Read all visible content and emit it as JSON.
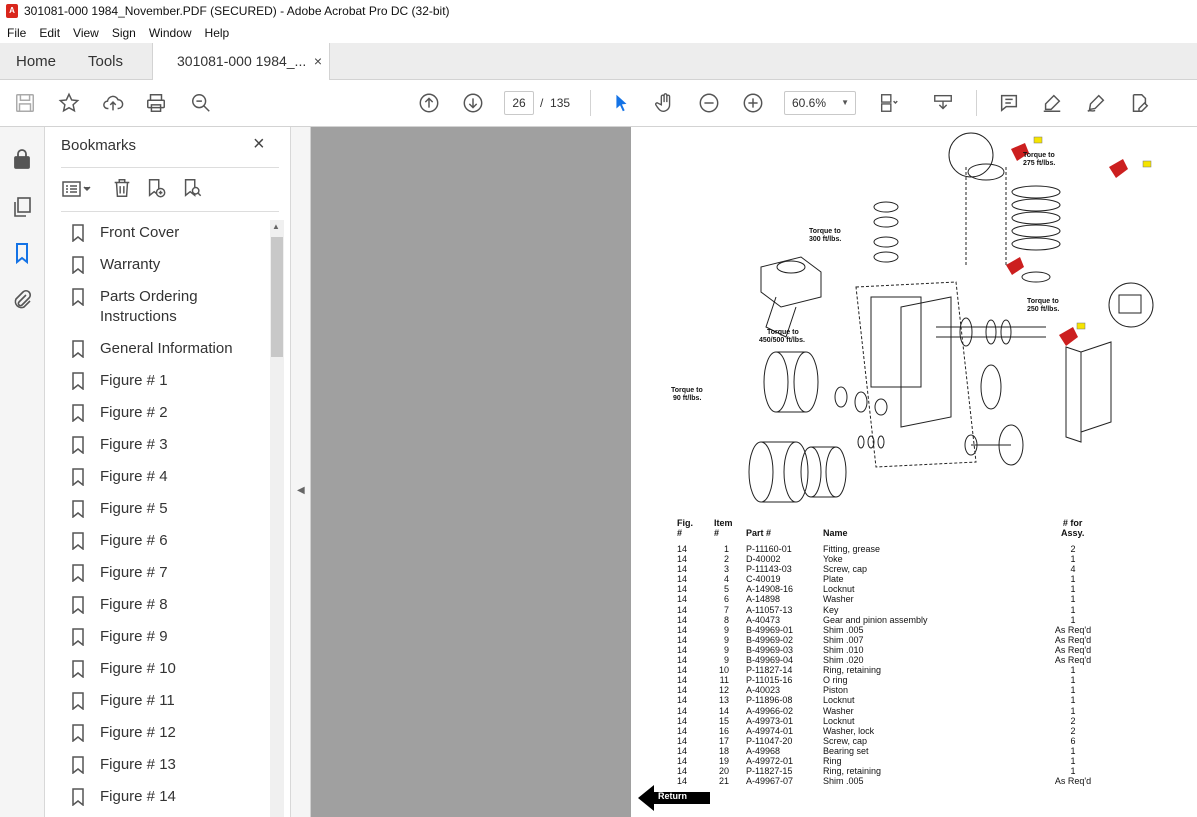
{
  "window": {
    "title": "301081-000 1984_November.PDF (SECURED) - Adobe Acrobat Pro DC (32-bit)"
  },
  "menu": [
    "File",
    "Edit",
    "View",
    "Sign",
    "Window",
    "Help"
  ],
  "tabs": {
    "home": "Home",
    "tools": "Tools",
    "document": "301081-000 1984_...",
    "close": "×"
  },
  "toolbar": {
    "page_current": "26",
    "page_separator": "/",
    "page_total": "135",
    "zoom": "60.6%"
  },
  "bookmarks_panel": {
    "title": "Bookmarks",
    "close": "×",
    "items": [
      "Front Cover",
      "Warranty",
      "Parts Ordering Instructions",
      "General Information",
      "Figure # 1",
      "Figure # 2",
      "Figure # 3",
      "Figure # 4",
      "Figure # 5",
      "Figure # 6",
      "Figure # 7",
      "Figure # 8",
      "Figure # 9",
      "Figure # 10",
      "Figure # 11",
      "Figure # 12",
      "Figure # 13",
      "Figure # 14"
    ]
  },
  "document": {
    "diagram_labels": {
      "torque_275": "Torque to\n275 ft/lbs.",
      "torque_300": "Torque to\n300 ft/lbs.",
      "torque_450": "Torque to\n450/500 ft/lbs.",
      "torque_90": "Torque to\n90 ft/lbs.",
      "torque_250": "Torque to\n250 ft/lbs."
    },
    "table_headers": {
      "fig": "Fig.\n#",
      "item": "Item\n#",
      "part": "Part #",
      "name": "Name",
      "qty": "# for\nAssy."
    },
    "rows": [
      [
        "14",
        "1",
        "P-11160-01",
        "Fitting, grease",
        "2"
      ],
      [
        "14",
        "2",
        "D-40002",
        "Yoke",
        "1"
      ],
      [
        "14",
        "3",
        "P-11143-03",
        "Screw, cap",
        "4"
      ],
      [
        "14",
        "4",
        "C-40019",
        "Plate",
        "1"
      ],
      [
        "14",
        "5",
        "A-14908-16",
        "Locknut",
        "1"
      ],
      [
        "14",
        "6",
        "A-14898",
        "Washer",
        "1"
      ],
      [
        "14",
        "7",
        "A-11057-13",
        "Key",
        "1"
      ],
      [
        "14",
        "8",
        "A-40473",
        "Gear and pinion assembly",
        "1"
      ],
      [
        "14",
        "9",
        "B-49969-01",
        "Shim .005",
        "As Req'd"
      ],
      [
        "14",
        "9",
        "B-49969-02",
        "Shim .007",
        "As Req'd"
      ],
      [
        "14",
        "9",
        "B-49969-03",
        "Shim .010",
        "As Req'd"
      ],
      [
        "14",
        "9",
        "B-49969-04",
        "Shim .020",
        "As Req'd"
      ],
      [
        "14",
        "10",
        "P-11827-14",
        "Ring, retaining",
        "1"
      ],
      [
        "14",
        "11",
        "P-11015-16",
        "O ring",
        "1"
      ],
      [
        "14",
        "12",
        "A-40023",
        "Piston",
        "1"
      ],
      [
        "14",
        "13",
        "P-11896-08",
        "Locknut",
        "1"
      ],
      [
        "14",
        "14",
        "A-49966-02",
        "Washer",
        "1"
      ],
      [
        "14",
        "15",
        "A-49973-01",
        "Locknut",
        "2"
      ],
      [
        "14",
        "16",
        "A-49974-01",
        "Washer, lock",
        "2"
      ],
      [
        "14",
        "17",
        "P-11047-20",
        "Screw, cap",
        "6"
      ],
      [
        "14",
        "18",
        "A-49968",
        "Bearing set",
        "1"
      ],
      [
        "14",
        "19",
        "A-49972-01",
        "Ring",
        "1"
      ],
      [
        "14",
        "20",
        "P-11827-15",
        "Ring, retaining",
        "1"
      ],
      [
        "14",
        "21",
        "A-49967-07",
        "Shim .005",
        "As Req'd"
      ]
    ],
    "return_label": "Return"
  }
}
